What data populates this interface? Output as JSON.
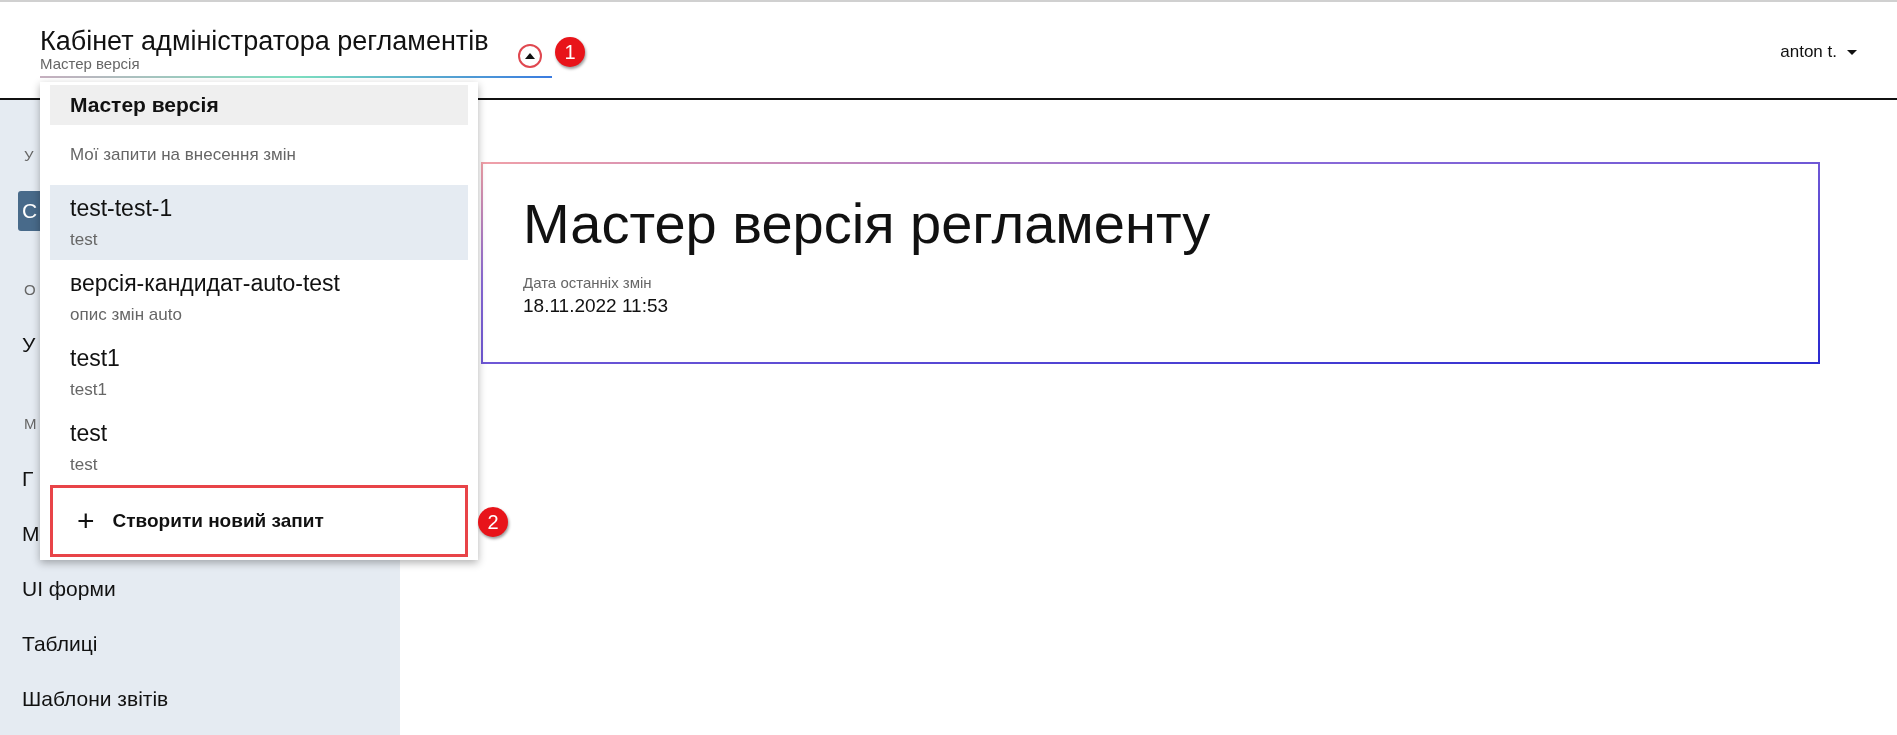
{
  "header": {
    "title": "Кабінет адміністратора регламентів",
    "subtitle": "Мастер версія",
    "expanded": true,
    "user": "anton t."
  },
  "sidebar": {
    "items": [
      {
        "kind": "label",
        "text": "У"
      },
      {
        "kind": "item",
        "text": "С",
        "selected": true
      },
      {
        "kind": "label",
        "text": "О"
      },
      {
        "kind": "item",
        "text": "У",
        "selected": false
      },
      {
        "kind": "label",
        "text": "М"
      },
      {
        "kind": "item",
        "text": "Г",
        "selected": false
      },
      {
        "kind": "item",
        "text": "М",
        "selected": false
      },
      {
        "kind": "item",
        "text": "UI форми",
        "selected": false
      },
      {
        "kind": "item",
        "text": "Таблиці",
        "selected": false
      },
      {
        "kind": "item",
        "text": "Шаблони звітів",
        "selected": false
      }
    ]
  },
  "dropdown": {
    "items": [
      {
        "kind": "master",
        "title": "Мастер версія"
      },
      {
        "kind": "heading",
        "title": "Мої запити на внесення змін"
      },
      {
        "kind": "request",
        "title": "test-test-1",
        "description": "test",
        "selected": true
      },
      {
        "kind": "request",
        "title": "версія-кандидат-auto-test",
        "description": "опис змін auto",
        "selected": false
      },
      {
        "kind": "request",
        "title": "test1",
        "description": "test1",
        "selected": false
      },
      {
        "kind": "request",
        "title": "test",
        "description": "test",
        "selected": false
      }
    ],
    "create_button": {
      "icon": "+",
      "label": "Створити новий запит"
    }
  },
  "card": {
    "title": "Мастер версія регламенту",
    "date_label": "Дата останніх змін",
    "date": "18.11.2022 11:53"
  },
  "annotations": [
    {
      "label": "1"
    },
    {
      "label": "2"
    }
  ]
}
